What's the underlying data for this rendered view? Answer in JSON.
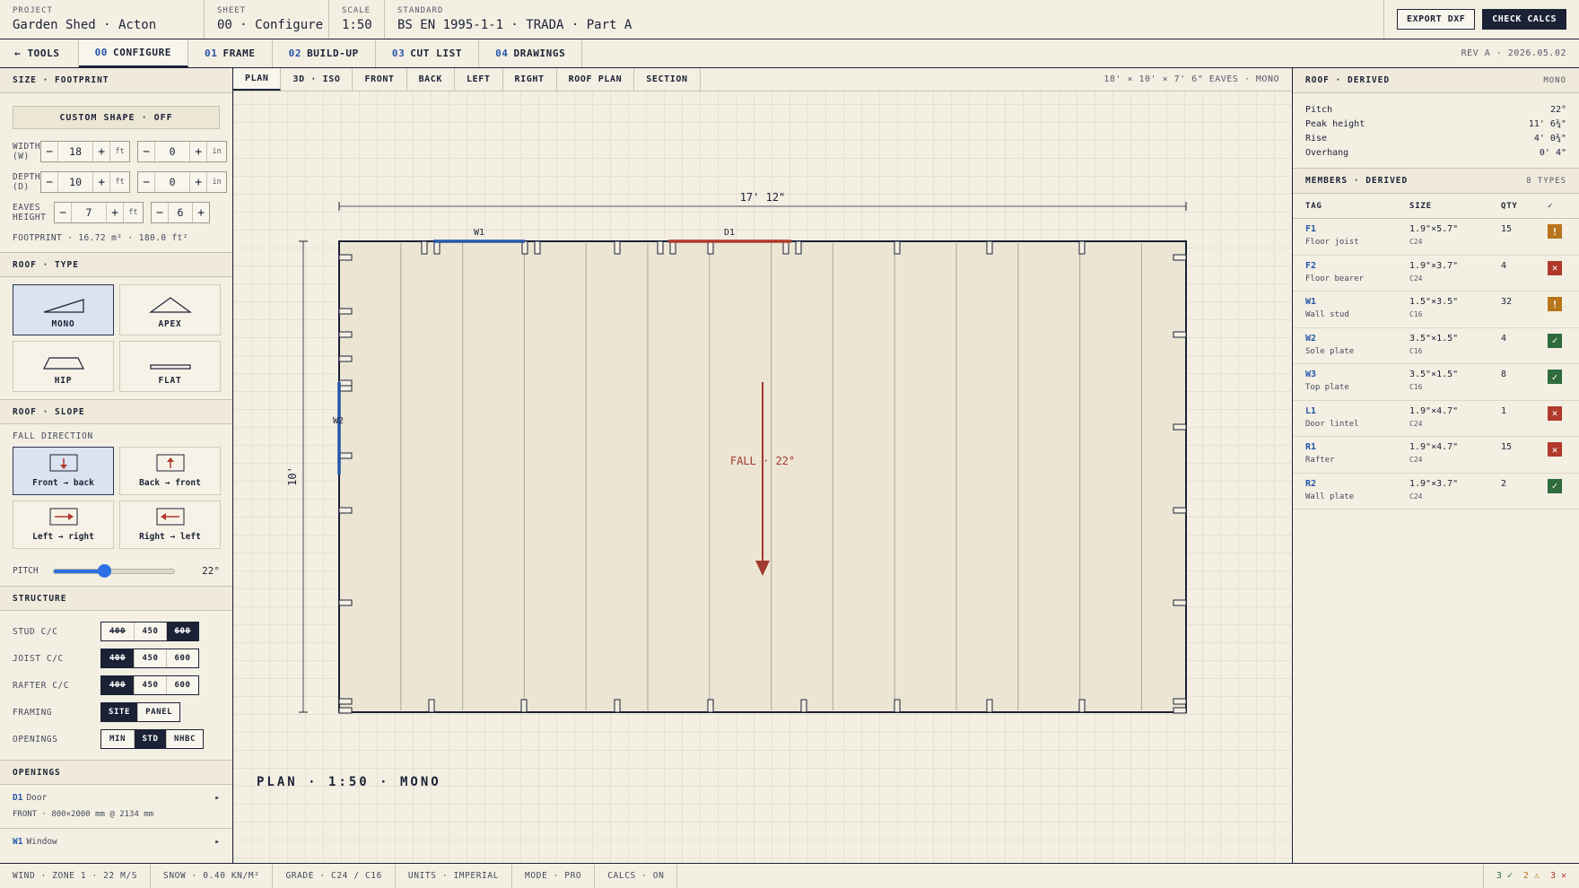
{
  "header": {
    "project_label": "PROJECT",
    "project": "Garden Shed · Acton",
    "sheet_label": "SHEET",
    "sheet": "00 · Configure",
    "scale_label": "SCALE",
    "scale": "1:50",
    "standard_label": "STANDARD",
    "standard": "BS EN 1995-1-1 · TRADA · Part A",
    "export": "EXPORT DXF",
    "check": "CHECK CALCS"
  },
  "nav": {
    "tools": "← TOOLS",
    "tabs": [
      {
        "num": "00",
        "label": "CONFIGURE"
      },
      {
        "num": "01",
        "label": "FRAME"
      },
      {
        "num": "02",
        "label": "BUILD-UP"
      },
      {
        "num": "03",
        "label": "CUT LIST"
      },
      {
        "num": "04",
        "label": "DRAWINGS"
      }
    ],
    "rev": "REV A · 2026.05.02"
  },
  "left": {
    "size_title": "SIZE · FOOTPRINT",
    "custom": "CUSTOM SHAPE · OFF",
    "width": {
      "label1": "WIDTH",
      "label2": "(W)",
      "ft": "18",
      "in": "0"
    },
    "depth": {
      "label1": "DEPTH",
      "label2": "(D)",
      "ft": "10",
      "in": "0"
    },
    "eaves": {
      "label1": "EAVES",
      "label2": "HEIGHT",
      "ft": "7",
      "in": "6"
    },
    "unit_ft": "ft",
    "unit_in": "in",
    "minus": "−",
    "plus": "+",
    "footprint": "FOOTPRINT · 16.72 m² · 180.0 ft²",
    "rooftype_title": "ROOF · TYPE",
    "rooftypes": [
      "MONO",
      "APEX",
      "HIP",
      "FLAT"
    ],
    "slope_title": "ROOF · SLOPE",
    "fall_label": "FALL DIRECTION",
    "directions": [
      "Front → back",
      "Back → front",
      "Left → right",
      "Right → left"
    ],
    "pitch_label": "PITCH",
    "pitch_value": "22°",
    "pitch_fraction": 0.42,
    "structure_title": "STRUCTURE",
    "stud": {
      "label": "STUD C/C",
      "opts": [
        "400",
        "450",
        "600"
      ]
    },
    "joist": {
      "label": "JOIST C/C",
      "opts": [
        "400",
        "450",
        "600"
      ]
    },
    "rafter": {
      "label": "RAFTER C/C",
      "opts": [
        "400",
        "450",
        "600"
      ]
    },
    "framing": {
      "label": "FRAMING",
      "opts": [
        "SITE",
        "PANEL"
      ]
    },
    "openings_opt": {
      "label": "OPENINGS",
      "opts": [
        "MIN",
        "STD",
        "NHBC"
      ]
    },
    "openings_title": "OPENINGS",
    "d1": {
      "tag": "D1",
      "name": "Door",
      "detail": "FRONT · 800×2000 mm @ 2134 mm"
    },
    "w1": {
      "tag": "W1",
      "name": "Window"
    },
    "caret": "▸"
  },
  "view": {
    "tabs": [
      "PLAN",
      "3D · ISO",
      "FRONT",
      "BACK",
      "LEFT",
      "RIGHT",
      "ROOF PLAN",
      "SECTION"
    ],
    "info": "18' × 10' × 7' 6\" EAVES · MONO",
    "dim_w": "17' 12\"",
    "dim_d": "10'",
    "w1": "W1",
    "d1": "D1",
    "w2": "W2",
    "fall": "FALL · 22°",
    "plan_label": "PLAN · 1:50 · MONO"
  },
  "right": {
    "roof_title": "ROOF · DERIVED",
    "roof_type": "MONO",
    "derived": [
      {
        "k": "Pitch",
        "v": "22°"
      },
      {
        "k": "Peak height",
        "v": "11' 6¾\""
      },
      {
        "k": "Rise",
        "v": "4' 0¾\""
      },
      {
        "k": "Overhang",
        "v": "0' 4\""
      }
    ],
    "members_title": "MEMBERS · DERIVED",
    "members_count": "8 TYPES",
    "cols": [
      "TAG",
      "SIZE",
      "QTY",
      "✓"
    ],
    "members": [
      {
        "tag": "F1",
        "desc": "Floor joist",
        "size": "1.9\"×5.7\"",
        "grade": "C24",
        "qty": "15",
        "status": "!"
      },
      {
        "tag": "F2",
        "desc": "Floor bearer",
        "size": "1.9\"×3.7\"",
        "grade": "C24",
        "qty": "4",
        "status": "✕"
      },
      {
        "tag": "W1",
        "desc": "Wall stud",
        "size": "1.5\"×3.5\"",
        "grade": "C16",
        "qty": "32",
        "status": "!"
      },
      {
        "tag": "W2",
        "desc": "Sole plate",
        "size": "3.5\"×1.5\"",
        "grade": "C16",
        "qty": "4",
        "status": "✓"
      },
      {
        "tag": "W3",
        "desc": "Top plate",
        "size": "3.5\"×1.5\"",
        "grade": "C16",
        "qty": "8",
        "status": "✓"
      },
      {
        "tag": "L1",
        "desc": "Door lintel",
        "size": "1.9\"×4.7\"",
        "grade": "C24",
        "qty": "1",
        "status": "✕"
      },
      {
        "tag": "R1",
        "desc": "Rafter",
        "size": "1.9\"×4.7\"",
        "grade": "C24",
        "qty": "15",
        "status": "✕"
      },
      {
        "tag": "R2",
        "desc": "Wall plate",
        "size": "1.9\"×3.7\"",
        "grade": "C24",
        "qty": "2",
        "status": "✓"
      }
    ]
  },
  "status": {
    "items": [
      "WIND · ZONE 1 · 22 M/S",
      "SNOW · 0.40 KN/M²",
      "GRADE · C24 / C16",
      "UNITS · IMPERIAL",
      "MODE · PRO",
      "CALCS · ON"
    ],
    "ok": "3 ✓",
    "warn": "2 ⚠",
    "bad": "3 ✕"
  },
  "colors": {
    "ink": "#1b2236",
    "accent_blue": "#2456a8",
    "accent_red": "#b0392b",
    "ok": "#2f6b3d",
    "warn": "#b8761c",
    "bad": "#b0392b"
  }
}
